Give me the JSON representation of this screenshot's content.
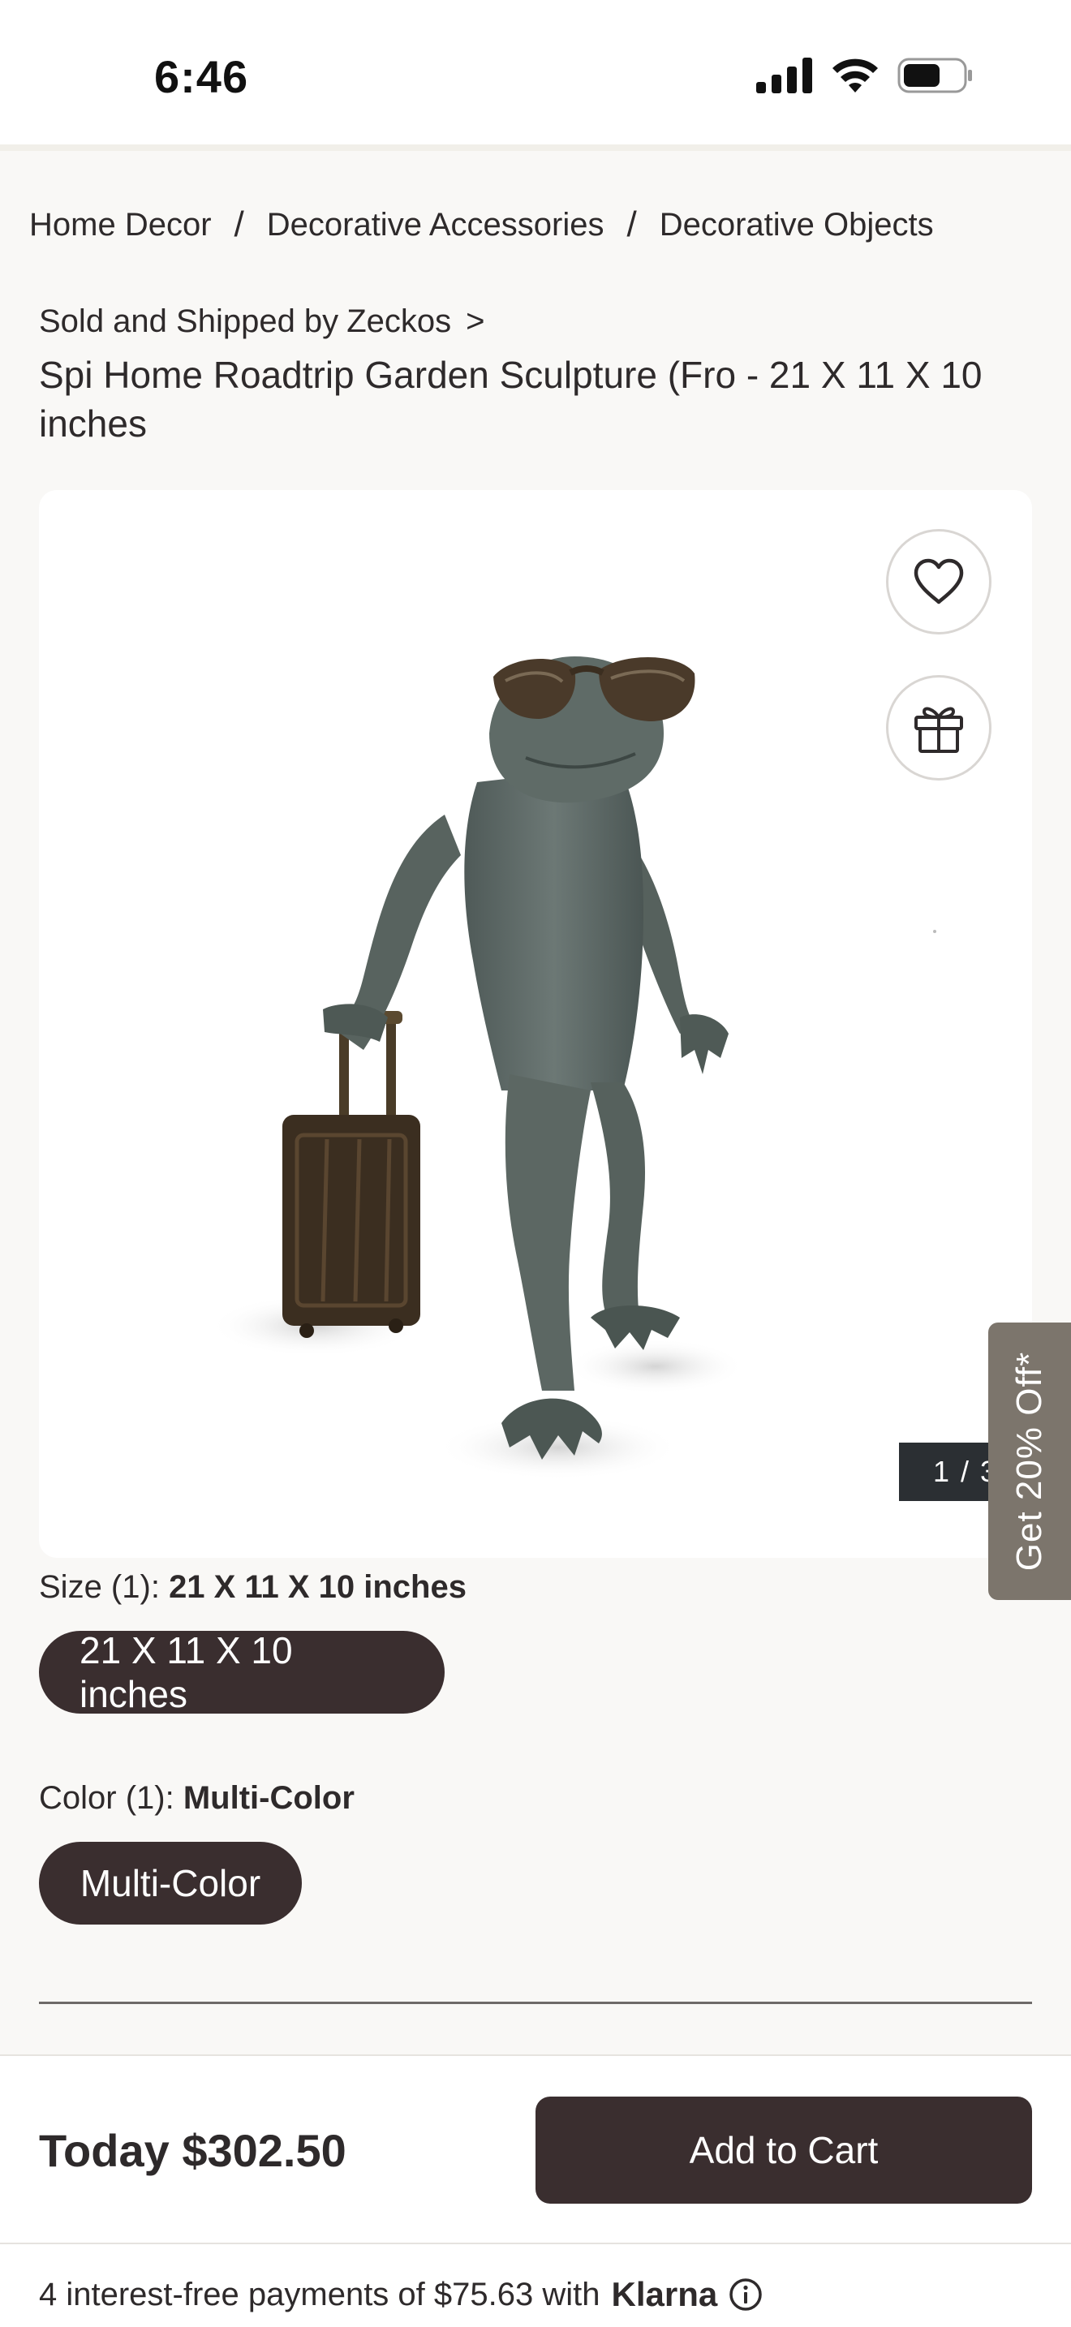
{
  "status_bar": {
    "time": "6:46",
    "icons": [
      "signal-icon",
      "wifi-icon",
      "battery-icon"
    ]
  },
  "breadcrumb": {
    "items": [
      "Home Decor",
      "Decorative Accessories",
      "Decorative Objects"
    ],
    "separator": "/"
  },
  "seller": {
    "prefix": "Sold and Shipped by",
    "name": "Zeckos",
    "chevron": ">"
  },
  "product": {
    "title": "Spi Home Roadtrip Garden Sculpture (Fro - 21 X 11 X 10 inches"
  },
  "gallery": {
    "pager": "1 / 3",
    "icons": [
      "heart-icon",
      "gift-icon"
    ]
  },
  "promo": {
    "label": "Get 20% Off*"
  },
  "options": {
    "size_label": "Size (1):",
    "size_value": "21 X 11 X 10 inches",
    "size_chip": "21 X 11 X 10 inches",
    "color_label": "Color (1):",
    "color_value": "Multi-Color",
    "color_chip": "Multi-Color"
  },
  "purchase": {
    "price": "Today $302.50",
    "add_to_cart": "Add to Cart",
    "installments": "4 interest-free payments of $75.63 with",
    "klarna": "Klarna"
  },
  "colors": {
    "primary_dark": "#3a2e2f",
    "promo_tab": "#7c756c",
    "pager_bg": "#2b2f33",
    "page_bg": "#f9f8f6"
  }
}
